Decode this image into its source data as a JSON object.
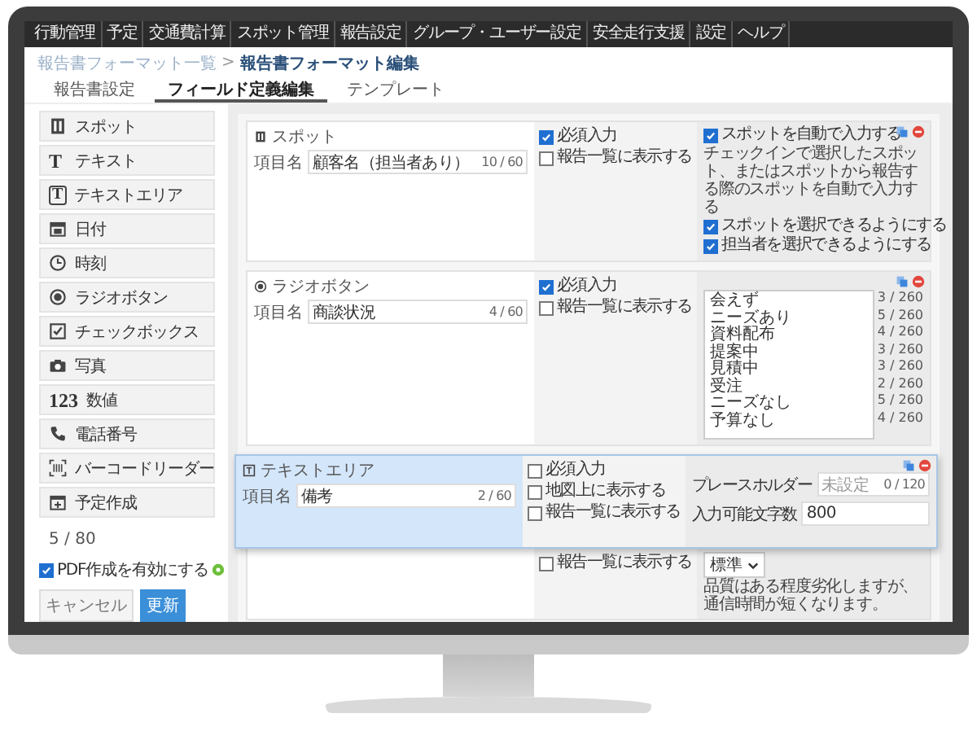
{
  "nav": {
    "items": [
      {
        "label": "行動管理"
      },
      {
        "label": "予定"
      },
      {
        "label": "交通費計算"
      },
      {
        "label": "スポット管理"
      },
      {
        "label": "報告設定"
      },
      {
        "label": "グループ・ユーザー設定"
      },
      {
        "label": "安全走行支援"
      },
      {
        "label": "設定"
      },
      {
        "label": "ヘルプ"
      }
    ]
  },
  "breadcrumb": {
    "parent": "報告書フォーマット一覧",
    "separator": ">",
    "current": "報告書フォーマット編集"
  },
  "tabs": [
    {
      "label": "報告書設定",
      "selected": false
    },
    {
      "label": "フィールド定義編集",
      "selected": true
    },
    {
      "label": "テンプレート",
      "selected": false
    }
  ],
  "palette": {
    "items": [
      {
        "kind": "spot",
        "label": "スポット"
      },
      {
        "kind": "text",
        "glyph": "T",
        "label": "テキスト"
      },
      {
        "kind": "textarea",
        "glyph": "T",
        "label": "テキストエリア"
      },
      {
        "kind": "date",
        "label": "日付"
      },
      {
        "kind": "time",
        "label": "時刻"
      },
      {
        "kind": "radio",
        "label": "ラジオボタン"
      },
      {
        "kind": "checkbox",
        "label": "チェックボックス"
      },
      {
        "kind": "photo",
        "label": "写真"
      },
      {
        "kind": "number",
        "glyph": "123",
        "label": "数値"
      },
      {
        "kind": "phone",
        "label": "電話番号"
      },
      {
        "kind": "barcode",
        "label": "バーコードリーダー"
      },
      {
        "kind": "schedule",
        "label": "予定作成"
      }
    ],
    "count": "5 / 80",
    "pdf": {
      "label": "PDF作成を有効にする",
      "checked": true
    },
    "buttons": [
      {
        "kind": "cancel",
        "label": "キャンセル"
      },
      {
        "kind": "primary",
        "label": "更新"
      }
    ]
  },
  "fields": [
    {
      "kind": "spot",
      "type_label": "スポット",
      "name_label": "項目名",
      "value": "顧客名（担当者あり）",
      "counter": "10 / 60",
      "flags": [
        {
          "label": "必須入力",
          "checked": true
        },
        {
          "label": "報告一覧に表示する",
          "checked": false
        }
      ],
      "options": [
        {
          "kind": "check",
          "label": "スポットを自動で入力する",
          "checked": true
        },
        {
          "kind": "note",
          "label": "チェックインで選択したスポット、またはスポットから報告する際のスポットを自動で入力する"
        },
        {
          "kind": "check",
          "label": "スポットを選択できるようにする",
          "checked": true
        },
        {
          "kind": "check",
          "label": "担当者を選択できるようにする",
          "checked": true
        }
      ]
    },
    {
      "kind": "radio",
      "type_label": "ラジオボタン",
      "name_label": "項目名",
      "value": "商談状況",
      "counter": "4 / 60",
      "flags": [
        {
          "label": "必須入力",
          "checked": true
        },
        {
          "label": "報告一覧に表示する",
          "checked": false
        }
      ],
      "choices": [
        {
          "label": "会えず",
          "counter": "3 / 260"
        },
        {
          "label": "ニーズあり",
          "counter": "5 / 260"
        },
        {
          "label": "資料配布",
          "counter": "4 / 260"
        },
        {
          "label": "提案中",
          "counter": "3 / 260"
        },
        {
          "label": "見積中",
          "counter": "3 / 260"
        },
        {
          "label": "受注",
          "counter": "2 / 260"
        },
        {
          "label": "ニーズなし",
          "counter": "5 / 260"
        },
        {
          "label": "予算なし",
          "counter": "4 / 260"
        }
      ]
    }
  ],
  "covered_field": {
    "flags": [
      {
        "label": "報告一覧に表示する",
        "checked": false
      }
    ],
    "select": "標準",
    "note": "品質はある程度劣化しますが、通信時間が短くなります。"
  },
  "dragged_field": {
    "type_label": "テキストエリア",
    "name_label": "項目名",
    "value": "備考",
    "counter": "2 / 60",
    "flags": [
      {
        "label": "必須入力",
        "checked": false
      },
      {
        "label": "地図上に表示する",
        "checked": false
      },
      {
        "label": "報告一覧に表示する",
        "checked": false
      }
    ],
    "placeholder_row": {
      "label": "プレースホルダー",
      "placeholder": "未設定",
      "counter": "0 / 120"
    },
    "max_row": {
      "label": "入力可能文字数",
      "value": "800"
    }
  }
}
